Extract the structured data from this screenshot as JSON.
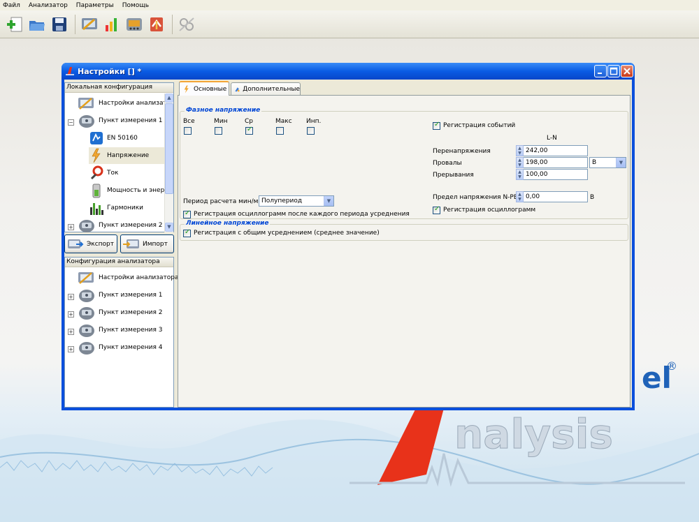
{
  "menu": [
    "Файл",
    "Анализатор",
    "Параметры",
    "Помощь"
  ],
  "toolbar_icons": [
    "new-icon",
    "open-folder-icon",
    "save-icon",
    "config-icon",
    "chart-icon",
    "analyzer-icon",
    "transfer-icon",
    "disconnect-icon"
  ],
  "brand": {
    "text": "el",
    "reg": "®",
    "logo_text": "nalysis"
  },
  "window": {
    "title": "Настройки [] *"
  },
  "local_config": {
    "header": "Локальная конфигурация",
    "items": [
      {
        "label": "Настройки анализат...",
        "icon": "analyzer-settings-icon",
        "level": 0
      },
      {
        "label": "Пункт измерения 1",
        "icon": "measurement-point-icon",
        "level": 0,
        "expanded": true
      },
      {
        "label": "EN 50160",
        "icon": "en50160-icon",
        "level": 1
      },
      {
        "label": "Напряжение",
        "icon": "voltage-icon",
        "level": 1,
        "selected": true
      },
      {
        "label": "Ток",
        "icon": "current-clamp-icon",
        "level": 1
      },
      {
        "label": "Мощность и энер...",
        "icon": "power-energy-icon",
        "level": 1
      },
      {
        "label": "Гармоники",
        "icon": "harmonics-icon",
        "level": 1
      },
      {
        "label": "Пункт измерения 2",
        "icon": "measurement-point-icon",
        "level": 0
      }
    ]
  },
  "buttons": {
    "export": "Экспорт",
    "import": "Импорт"
  },
  "analyzer_config": {
    "header": "Конфигурация анализатора",
    "items": [
      {
        "label": "Настройки анализатора",
        "icon": "analyzer-settings-icon"
      },
      {
        "label": "Пункт измерения 1",
        "icon": "measurement-point-icon"
      },
      {
        "label": "Пункт измерения 2",
        "icon": "measurement-point-icon"
      },
      {
        "label": "Пункт измерения 3",
        "icon": "measurement-point-icon"
      },
      {
        "label": "Пункт измерения 4",
        "icon": "measurement-point-icon"
      }
    ]
  },
  "tabs": [
    {
      "label": "Основные",
      "active": true
    },
    {
      "label": "Дополнительные",
      "active": false
    }
  ],
  "phase_voltage": {
    "title": "Фазное напряжение",
    "checks": [
      {
        "label": "Все",
        "checked": false
      },
      {
        "label": "Мин",
        "checked": false
      },
      {
        "label": "Ср",
        "checked": true
      },
      {
        "label": "Макс",
        "checked": false
      },
      {
        "label": "Инп.",
        "checked": false
      }
    ],
    "period_label": "Период расчета мин/макс:",
    "period_value": "Полупериод",
    "osc_after_period": {
      "label": "Регистрация осциллограмм после каждого периода усреднения",
      "checked": true
    },
    "event_registration": {
      "label": "Регистрация событий",
      "checked": true
    },
    "column_header": "L-N",
    "overvoltage": {
      "label": "Перенапряжения",
      "value": "242,00"
    },
    "dips": {
      "label": "Провалы",
      "value": "198,00",
      "unit": "В"
    },
    "interruptions": {
      "label": "Прерывания",
      "value": "100,00"
    },
    "npe_limit": {
      "label": "Предел напряжения N-PE",
      "value": "0,00",
      "unit": "В"
    },
    "osc_registration": {
      "label": "Регистрация осциллограмм",
      "checked": true
    }
  },
  "line_voltage": {
    "title": "Линейное напряжение",
    "common_avg": {
      "label": "Регистрация с общим усреднением (среднее значение)",
      "checked": true
    }
  }
}
